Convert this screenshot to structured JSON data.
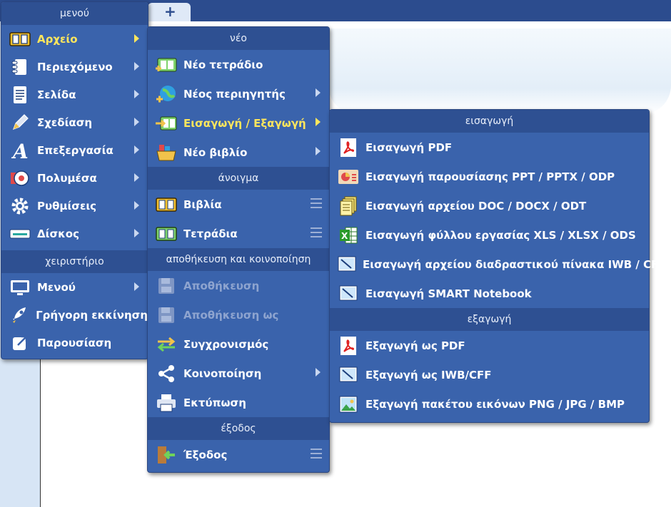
{
  "background": {
    "tab_add": "+"
  },
  "main_menu": {
    "header": "μενού",
    "items": [
      {
        "label": "Αρχείο",
        "icon": "book-icon"
      },
      {
        "label": "Περιεχόμενο",
        "icon": "notebook-icon"
      },
      {
        "label": "Σελίδα",
        "icon": "page-icon"
      },
      {
        "label": "Σχεδίαση",
        "icon": "pencil-icon"
      },
      {
        "label": "Επεξεργασία",
        "icon": "letter-a-icon"
      },
      {
        "label": "Πολυμέσα",
        "icon": "media-icon"
      },
      {
        "label": "Ρυθμίσεις",
        "icon": "gear-icon"
      },
      {
        "label": "Δίσκος",
        "icon": "disk-icon"
      }
    ],
    "section2": "χειριστήριο",
    "items2": [
      {
        "label": "Μενού",
        "icon": "monitor-icon"
      },
      {
        "label": "Γρήγορη εκκίνηση",
        "icon": "rocket-icon"
      },
      {
        "label": "Παρουσίαση",
        "icon": "present-icon"
      }
    ]
  },
  "file_menu": {
    "header_new": "νέο",
    "new_items": [
      {
        "label": "Νέο τετράδιο"
      },
      {
        "label": "Νέος περιηγητής"
      },
      {
        "label": "Εισαγωγή / Εξαγωγή"
      },
      {
        "label": "Νέο βιβλίο"
      }
    ],
    "header_open": "άνοιγμα",
    "open_items": [
      {
        "label": "Βιβλία"
      },
      {
        "label": "Τετράδια"
      }
    ],
    "header_save": "αποθήκευση και κοινοποίηση",
    "save_items": [
      {
        "label": "Αποθήκευση"
      },
      {
        "label": "Αποθήκευση ως"
      },
      {
        "label": "Συγχρονισμός"
      },
      {
        "label": "Κοινοποίηση"
      },
      {
        "label": "Εκτύπωση"
      }
    ],
    "header_exit": "έξοδος",
    "exit_item": {
      "label": "Έξοδος"
    }
  },
  "io_menu": {
    "header_import": "εισαγωγή",
    "import_items": [
      {
        "label": "Εισαγωγή PDF"
      },
      {
        "label": "Εισαγωγή παρουσίασης PPT / PPTX / ODP"
      },
      {
        "label": "Εισαγωγή αρχείου DOC / DOCX / ODT"
      },
      {
        "label": "Εισαγωγή φύλλου εργασίας XLS / XLSX / ODS"
      },
      {
        "label": "Εισαγωγή αρχείου διαδραστικού πίνακα IWB / CFF"
      },
      {
        "label": "Εισαγωγή SMART Notebook"
      }
    ],
    "header_export": "εξαγωγή",
    "export_items": [
      {
        "label": "Εξαγωγή ως PDF"
      },
      {
        "label": "Εξαγωγή ως IWB/CFF"
      },
      {
        "label": "Εξαγωγή πακέτου εικόνων PNG / JPG / BMP"
      }
    ]
  },
  "colors": {
    "menu_bg": "#3a63ac",
    "header_bg": "#2e5092",
    "active_text": "#ffe65c"
  }
}
